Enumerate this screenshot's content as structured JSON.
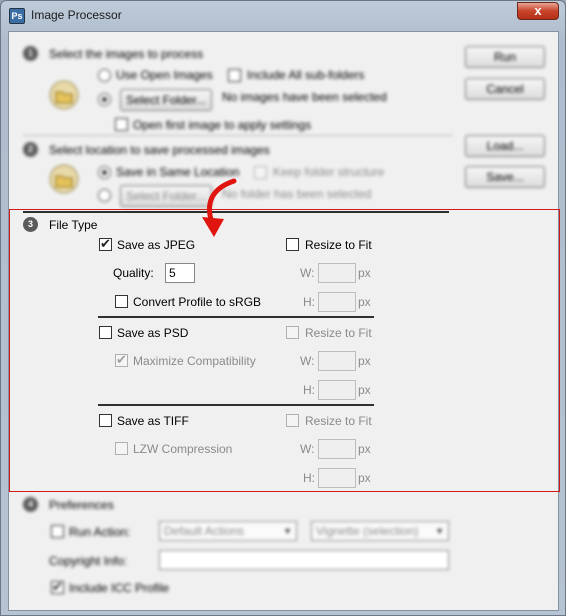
{
  "window": {
    "title": "Image Processor",
    "close_glyph": "x",
    "app_icon_glyph": "Ps"
  },
  "section1": {
    "number": "1",
    "title": "Select the images to process",
    "use_open_images": "Use Open Images",
    "include_subfolders": "Include All sub-folders",
    "select_folder": "Select Folder...",
    "status": "No images have been selected",
    "open_first": "Open first image to apply settings"
  },
  "section2": {
    "number": "2",
    "title": "Select location to save processed images",
    "save_same": "Save in Same Location",
    "keep_structure": "Keep folder structure",
    "select_folder": "Select Folder...",
    "status": "No folder has been selected"
  },
  "section3": {
    "number": "3",
    "title": "File Type",
    "jpeg": {
      "save_as": "Save as JPEG",
      "save_checked": true,
      "resize": "Resize to Fit",
      "resize_checked": false,
      "quality_label": "Quality:",
      "quality_value": "5",
      "convert_profile": "Convert Profile to sRGB",
      "convert_checked": false,
      "w_label": "W:",
      "h_label": "H:",
      "unit": "px"
    },
    "psd": {
      "save_as": "Save as PSD",
      "save_checked": false,
      "resize": "Resize to Fit",
      "maximize": "Maximize Compatibility",
      "maximize_checked": true,
      "w_label": "W:",
      "h_label": "H:",
      "unit": "px"
    },
    "tiff": {
      "save_as": "Save as TIFF",
      "save_checked": false,
      "resize": "Resize to Fit",
      "lzw": "LZW Compression",
      "lzw_checked": false,
      "w_label": "W:",
      "h_label": "H:",
      "unit": "px"
    }
  },
  "section4": {
    "number": "4",
    "title": "Preferences",
    "run_action": "Run Action:",
    "action_set": "Default Actions",
    "action": "Vignette (selection)",
    "copyright_label": "Copyright Info:",
    "copyright_value": "",
    "include_icc": "Include ICC Profile"
  },
  "buttons": {
    "run": "Run",
    "cancel": "Cancel",
    "load": "Load...",
    "save": "Save..."
  },
  "colors": {
    "focus_box": "#d21a1a",
    "arrow": "#e0150f"
  }
}
